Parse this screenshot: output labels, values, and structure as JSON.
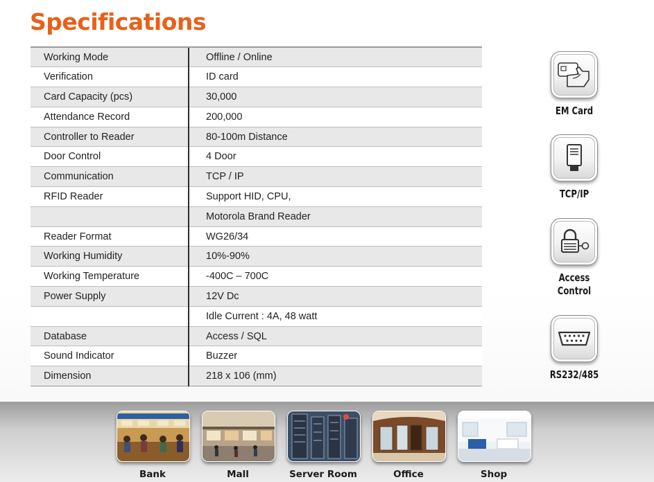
{
  "page": {
    "title": "Specifications",
    "accent_color": "#e8611a"
  },
  "specs": [
    {
      "label": "Working Mode",
      "value": "Offline / Online"
    },
    {
      "label": "Verification",
      "value": "ID card"
    },
    {
      "label": "Card Capacity (pcs)",
      "value": "30,000"
    },
    {
      "label": "Attendance Record",
      "value": "200,000"
    },
    {
      "label": "Controller to Reader",
      "value": "80-100m Distance"
    },
    {
      "label": "Door Control",
      "value": "4 Door"
    },
    {
      "label": "Communication",
      "value": "TCP / IP"
    },
    {
      "label": "RFID Reader",
      "value": "Support HID, CPU,"
    },
    {
      "label": "",
      "value": "Motorola Brand Reader"
    },
    {
      "label": "Reader Format",
      "value": "WG26/34"
    },
    {
      "label": "Working Humidity",
      "value": "10%-90%"
    },
    {
      "label": "Working Temperature",
      "value": "-400C – 700C"
    },
    {
      "label": "Power Supply",
      "value": "12V Dc"
    },
    {
      "label": "",
      "value": "Idle Current : 4A, 48 watt"
    },
    {
      "label": "Database",
      "value": "Access / SQL"
    },
    {
      "label": "Sound Indicator",
      "value": "Buzzer"
    },
    {
      "label": "Dimension",
      "value": "218 x 106 (mm)"
    }
  ],
  "features": [
    {
      "icon": "em-card-icon",
      "line1": "EM Card",
      "line2": ""
    },
    {
      "icon": "ethernet-port-icon",
      "line1": "TCP/IP",
      "line2": ""
    },
    {
      "icon": "access-control-icon",
      "line1": "Access",
      "line2": "Control"
    },
    {
      "icon": "serial-port-icon",
      "line1": "RS232/485",
      "line2": ""
    }
  ],
  "applications": [
    {
      "icon": "bank-photo",
      "label": "Bank"
    },
    {
      "icon": "mall-photo",
      "label": "Mall"
    },
    {
      "icon": "server-room-photo",
      "label": "Server Room"
    },
    {
      "icon": "office-photo",
      "label": "Office"
    },
    {
      "icon": "shop-photo",
      "label": "Shop"
    }
  ]
}
